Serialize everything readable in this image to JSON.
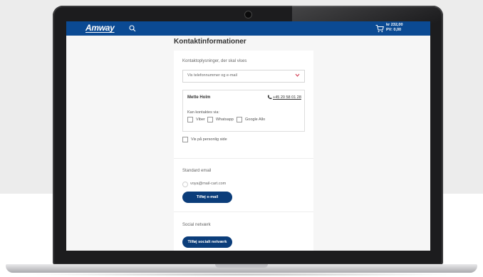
{
  "header": {
    "logo": "Amway",
    "cart_amount": "kr 232,00",
    "cart_pv": "PV: 0,00"
  },
  "page": {
    "title": "Kontaktinformationer"
  },
  "contact": {
    "display_label": "Kontaktoplysninger, der skal vises",
    "display_select_value": "Vis telefonnummer og e-mail",
    "name": "Mette Holm",
    "phone": "+45 20 58 01 28",
    "contactable_label": "Kan kontaktes via:",
    "channels": [
      "Viber",
      "Whatsapp",
      "Google Allo"
    ],
    "personal_page_label": "Vis på personlig side"
  },
  "email": {
    "section_label": "Standard email",
    "value": "voya@mail-cart.com",
    "add_button": "Tilføj e-mail"
  },
  "social": {
    "section_label": "Social netværk",
    "add_button": "Tilføj socialt netværk"
  },
  "colors": {
    "nav": "#0b4a93",
    "button": "#0b3d7a",
    "chevron": "#d0344a"
  }
}
